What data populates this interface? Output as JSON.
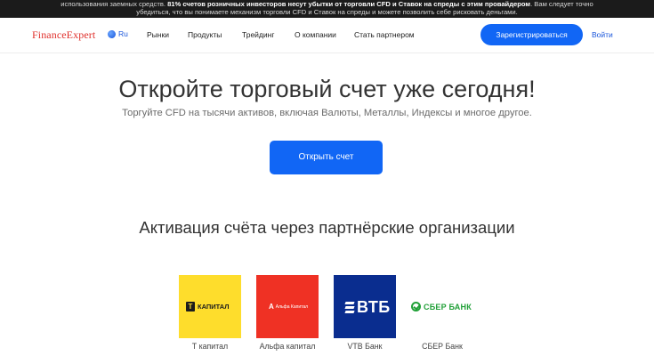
{
  "risk_warning": {
    "before": "использования заемных средств. ",
    "bold": "81% счетов розничных инвесторов несут убытки от торговли CFD и Ставок на спреды с этим провайдером",
    "after": ". Вам следует точно",
    "line2": "убедиться, что вы понимаете механизм торговли CFD и Ставок на спреды и можете позволить себе рисковать деньгами."
  },
  "header": {
    "logo": "FinanceExpert",
    "language": "Ru",
    "nav": [
      "Рынки",
      "Продукты",
      "Трейдинг",
      "О компании",
      "Стать партнером"
    ],
    "register_label": "Зарегистрироваться",
    "login_label": "Войти"
  },
  "hero": {
    "title": "Откройте торговый счет уже сегодня!",
    "subtitle": "Торгуйте CFD на тысячи активов, включая Валюты, Металлы, Индексы и многое другое.",
    "cta_label": "Открыть счет"
  },
  "partners": {
    "title": "Активация счёта через партнёрские организации",
    "items": [
      {
        "name": "Т капитал",
        "logo_text": "КАПИТАЛ",
        "logo_mark": "Т",
        "color": "#fedd2c"
      },
      {
        "name": "Альфа капитал",
        "logo_text": "Альфа Капитал",
        "logo_mark": "А",
        "color": "#ef3124"
      },
      {
        "name": "VTB Банк",
        "logo_text": "ВТБ",
        "color": "#0a2d8f"
      },
      {
        "name": "СБЕР Банк",
        "logo_text": "СБЕР БАНК",
        "color": "#21a038"
      }
    ]
  },
  "colors": {
    "accent": "#1166f5",
    "brand": "#e0302c"
  }
}
